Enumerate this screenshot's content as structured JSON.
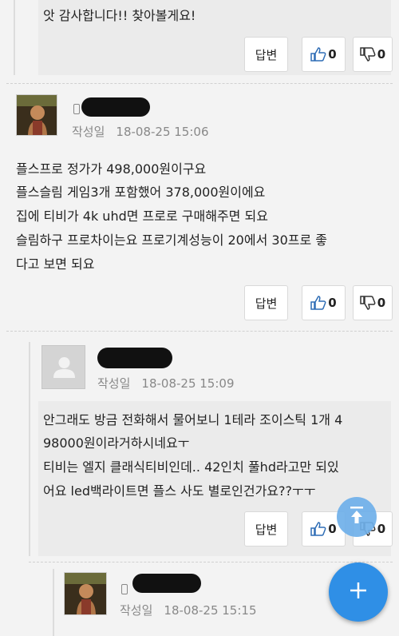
{
  "comments": [
    {
      "id": "reply-0",
      "text_lines": [
        "앗 감사합니다!! 찾아볼게요!"
      ],
      "reply_label": "답변",
      "likes": "0",
      "dislikes": "0"
    },
    {
      "id": "comment-1",
      "date_label": "작성일",
      "date": "18-08-25 15:06",
      "text_lines": [
        "플스프로 정가가 498,000원이구요",
        "플스슬림 게임3개 포함했어 378,000원이에요",
        "집에 티비가 4k uhd면 프로로 구매해주면 되요",
        "슬림하구 프로차이는요 프로기계성능이 20에서 30프로 좋",
        "다고 보면 되요"
      ],
      "reply_label": "답변",
      "likes": "0",
      "dislikes": "0"
    },
    {
      "id": "reply-2",
      "date_label": "작성일",
      "date": "18-08-25 15:09",
      "text_lines": [
        "안그래도 방금 전화해서 물어보니 1테라 조이스틱 1개 4",
        "98000원이라거하시네요ㅜ",
        "티비는 엘지 클래식티비인데.. 42인치 풀hd라고만 되있",
        "어요 led백라이트면 플스 사도 별로인건가요??ㅜㅜ"
      ],
      "reply_label": "답변",
      "likes": "0",
      "dislikes": "0"
    },
    {
      "id": "reply-3",
      "date_label": "작성일",
      "date": "18-08-25 15:15"
    }
  ],
  "colors": {
    "accent_blue": "#2f8fe6",
    "scroll_fab": "#6fb0ea"
  },
  "icons": {
    "like": "thumbs-up-icon",
    "dislike": "thumbs-down-icon",
    "scroll_top": "arrow-up-icon",
    "add": "plus-icon",
    "mobile": "mobile-phone-icon",
    "default_avatar": "user-silhouette-icon"
  }
}
